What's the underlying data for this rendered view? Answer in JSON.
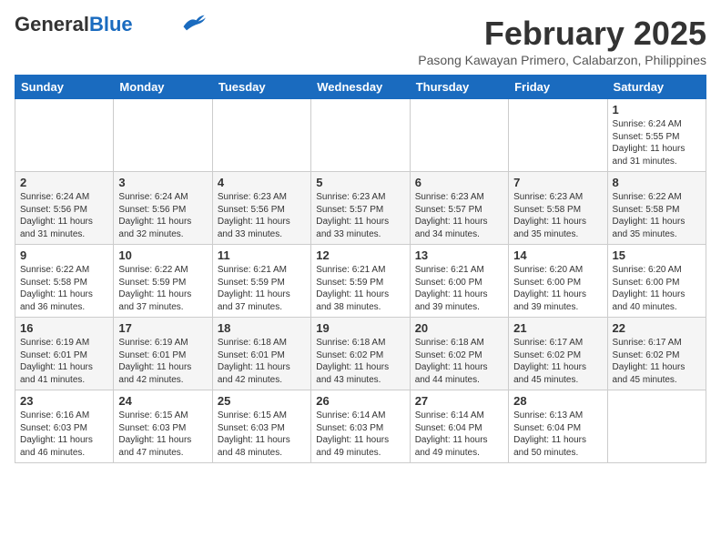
{
  "logo": {
    "general": "General",
    "blue": "Blue"
  },
  "header": {
    "month": "February 2025",
    "location": "Pasong Kawayan Primero, Calabarzon, Philippines"
  },
  "weekdays": [
    "Sunday",
    "Monday",
    "Tuesday",
    "Wednesday",
    "Thursday",
    "Friday",
    "Saturday"
  ],
  "weeks": [
    [
      {
        "day": "",
        "info": ""
      },
      {
        "day": "",
        "info": ""
      },
      {
        "day": "",
        "info": ""
      },
      {
        "day": "",
        "info": ""
      },
      {
        "day": "",
        "info": ""
      },
      {
        "day": "",
        "info": ""
      },
      {
        "day": "1",
        "info": "Sunrise: 6:24 AM\nSunset: 5:55 PM\nDaylight: 11 hours\nand 31 minutes."
      }
    ],
    [
      {
        "day": "2",
        "info": "Sunrise: 6:24 AM\nSunset: 5:56 PM\nDaylight: 11 hours\nand 31 minutes."
      },
      {
        "day": "3",
        "info": "Sunrise: 6:24 AM\nSunset: 5:56 PM\nDaylight: 11 hours\nand 32 minutes."
      },
      {
        "day": "4",
        "info": "Sunrise: 6:23 AM\nSunset: 5:56 PM\nDaylight: 11 hours\nand 33 minutes."
      },
      {
        "day": "5",
        "info": "Sunrise: 6:23 AM\nSunset: 5:57 PM\nDaylight: 11 hours\nand 33 minutes."
      },
      {
        "day": "6",
        "info": "Sunrise: 6:23 AM\nSunset: 5:57 PM\nDaylight: 11 hours\nand 34 minutes."
      },
      {
        "day": "7",
        "info": "Sunrise: 6:23 AM\nSunset: 5:58 PM\nDaylight: 11 hours\nand 35 minutes."
      },
      {
        "day": "8",
        "info": "Sunrise: 6:22 AM\nSunset: 5:58 PM\nDaylight: 11 hours\nand 35 minutes."
      }
    ],
    [
      {
        "day": "9",
        "info": "Sunrise: 6:22 AM\nSunset: 5:58 PM\nDaylight: 11 hours\nand 36 minutes."
      },
      {
        "day": "10",
        "info": "Sunrise: 6:22 AM\nSunset: 5:59 PM\nDaylight: 11 hours\nand 37 minutes."
      },
      {
        "day": "11",
        "info": "Sunrise: 6:21 AM\nSunset: 5:59 PM\nDaylight: 11 hours\nand 37 minutes."
      },
      {
        "day": "12",
        "info": "Sunrise: 6:21 AM\nSunset: 5:59 PM\nDaylight: 11 hours\nand 38 minutes."
      },
      {
        "day": "13",
        "info": "Sunrise: 6:21 AM\nSunset: 6:00 PM\nDaylight: 11 hours\nand 39 minutes."
      },
      {
        "day": "14",
        "info": "Sunrise: 6:20 AM\nSunset: 6:00 PM\nDaylight: 11 hours\nand 39 minutes."
      },
      {
        "day": "15",
        "info": "Sunrise: 6:20 AM\nSunset: 6:00 PM\nDaylight: 11 hours\nand 40 minutes."
      }
    ],
    [
      {
        "day": "16",
        "info": "Sunrise: 6:19 AM\nSunset: 6:01 PM\nDaylight: 11 hours\nand 41 minutes."
      },
      {
        "day": "17",
        "info": "Sunrise: 6:19 AM\nSunset: 6:01 PM\nDaylight: 11 hours\nand 42 minutes."
      },
      {
        "day": "18",
        "info": "Sunrise: 6:18 AM\nSunset: 6:01 PM\nDaylight: 11 hours\nand 42 minutes."
      },
      {
        "day": "19",
        "info": "Sunrise: 6:18 AM\nSunset: 6:02 PM\nDaylight: 11 hours\nand 43 minutes."
      },
      {
        "day": "20",
        "info": "Sunrise: 6:18 AM\nSunset: 6:02 PM\nDaylight: 11 hours\nand 44 minutes."
      },
      {
        "day": "21",
        "info": "Sunrise: 6:17 AM\nSunset: 6:02 PM\nDaylight: 11 hours\nand 45 minutes."
      },
      {
        "day": "22",
        "info": "Sunrise: 6:17 AM\nSunset: 6:02 PM\nDaylight: 11 hours\nand 45 minutes."
      }
    ],
    [
      {
        "day": "23",
        "info": "Sunrise: 6:16 AM\nSunset: 6:03 PM\nDaylight: 11 hours\nand 46 minutes."
      },
      {
        "day": "24",
        "info": "Sunrise: 6:15 AM\nSunset: 6:03 PM\nDaylight: 11 hours\nand 47 minutes."
      },
      {
        "day": "25",
        "info": "Sunrise: 6:15 AM\nSunset: 6:03 PM\nDaylight: 11 hours\nand 48 minutes."
      },
      {
        "day": "26",
        "info": "Sunrise: 6:14 AM\nSunset: 6:03 PM\nDaylight: 11 hours\nand 49 minutes."
      },
      {
        "day": "27",
        "info": "Sunrise: 6:14 AM\nSunset: 6:04 PM\nDaylight: 11 hours\nand 49 minutes."
      },
      {
        "day": "28",
        "info": "Sunrise: 6:13 AM\nSunset: 6:04 PM\nDaylight: 11 hours\nand 50 minutes."
      },
      {
        "day": "",
        "info": ""
      }
    ]
  ]
}
